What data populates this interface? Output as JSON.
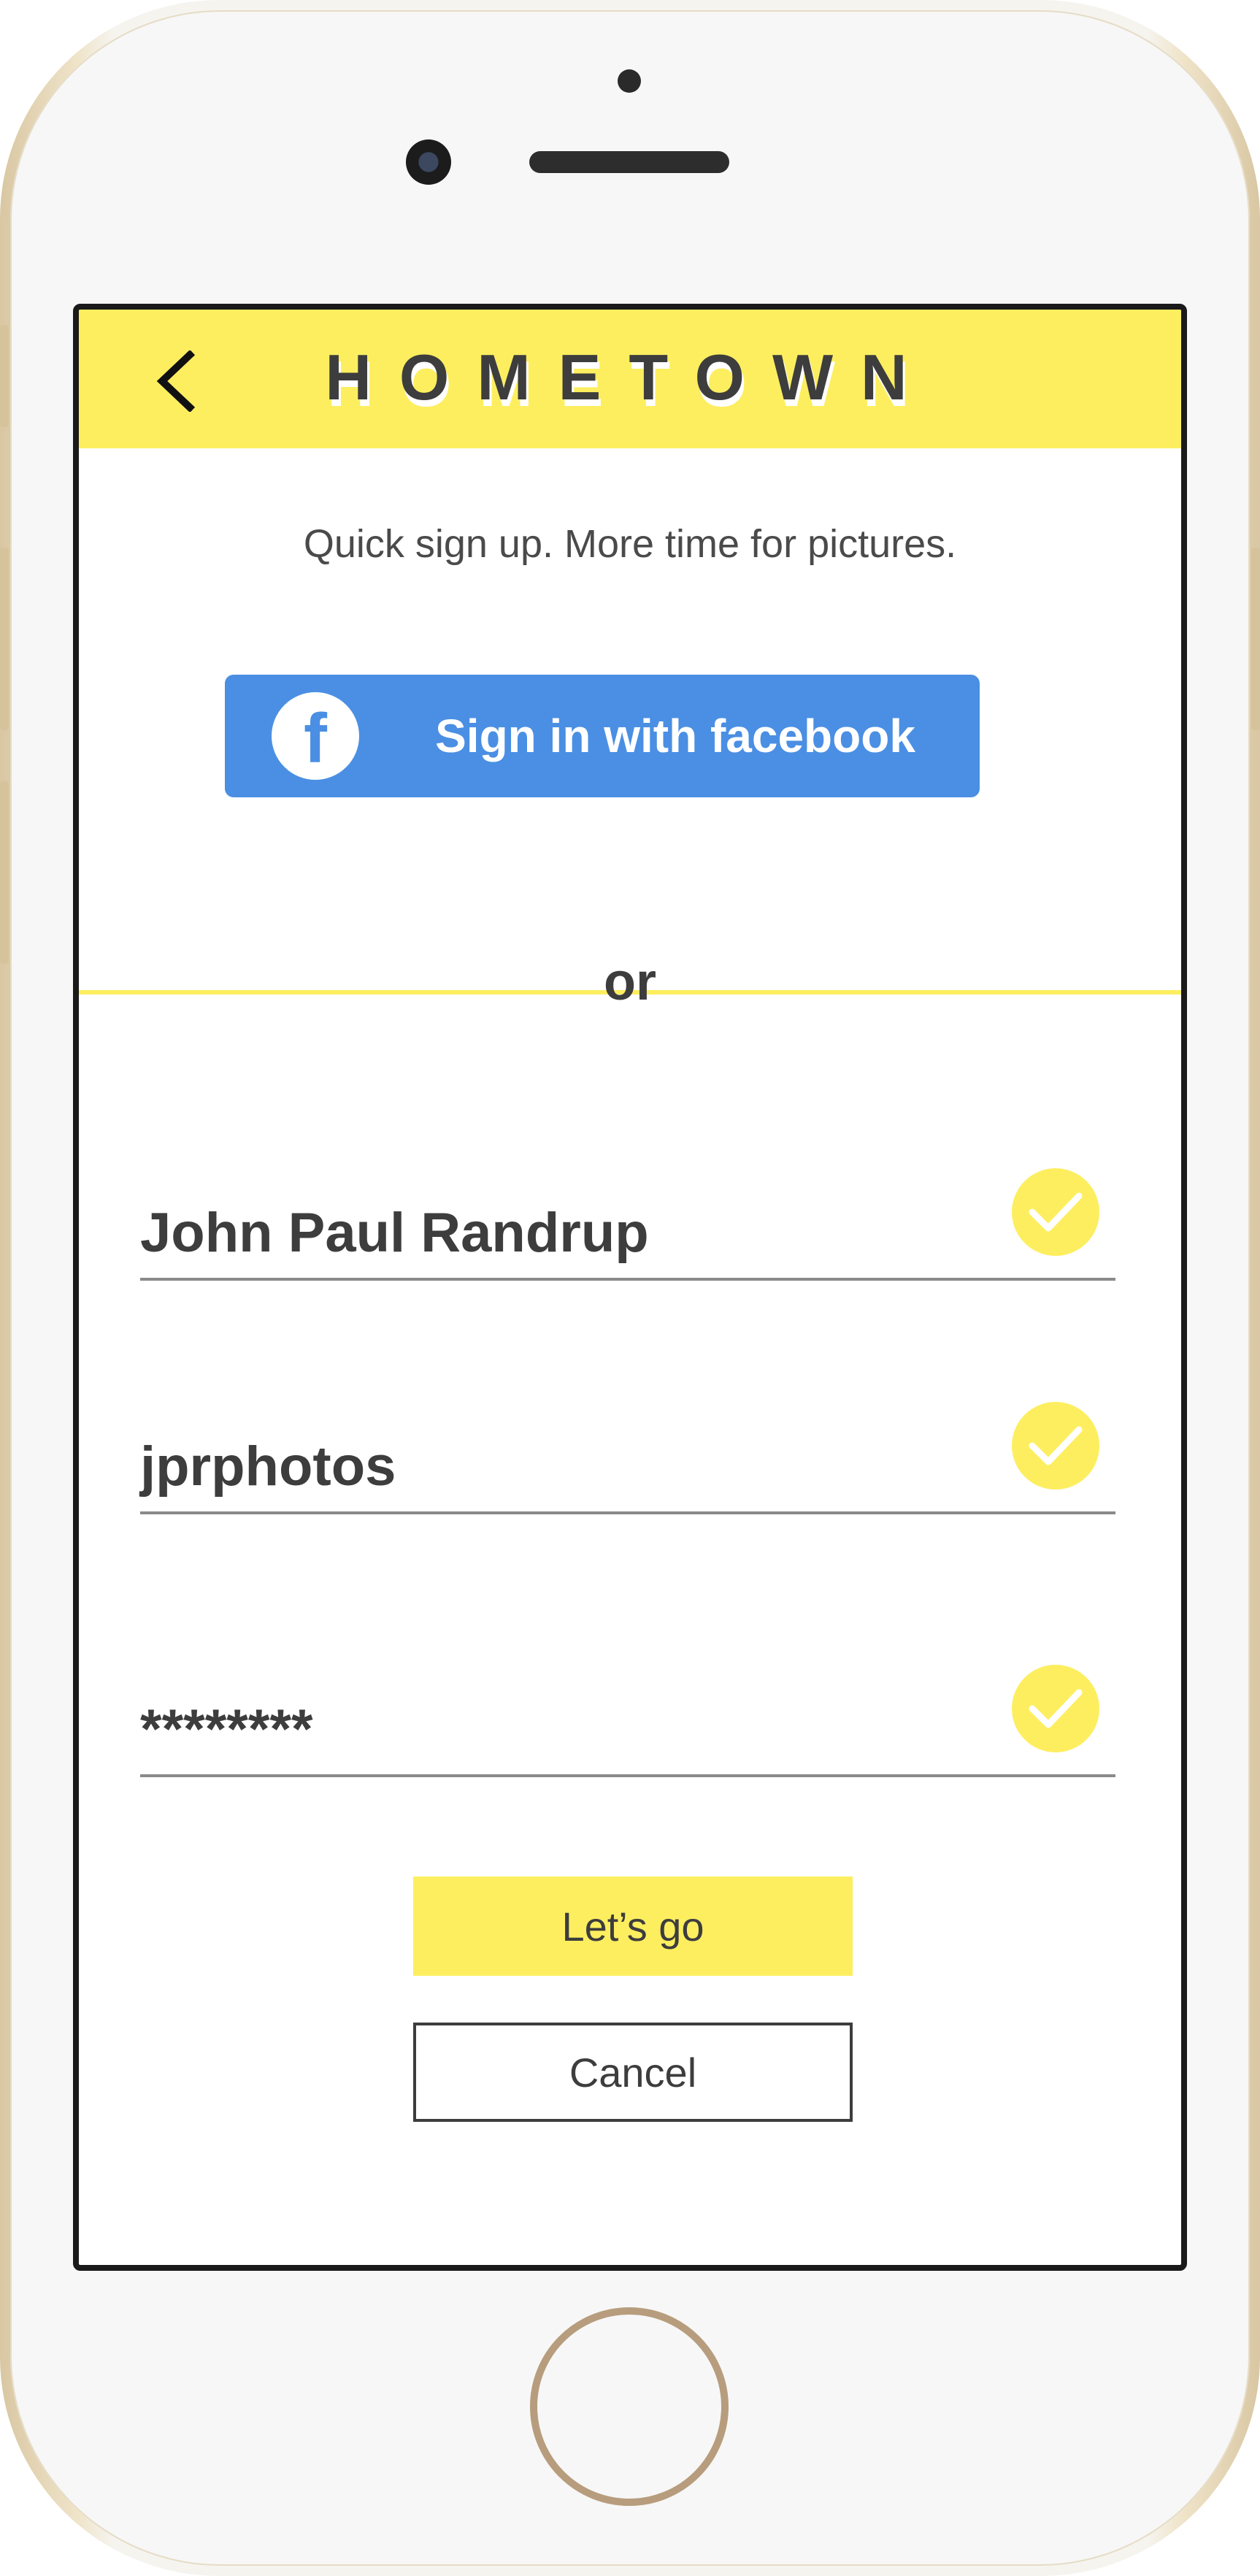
{
  "header": {
    "title": "HOMETOWN",
    "back_icon": "chevron-left-icon"
  },
  "tagline": "Quick sign up. More time for pictures.",
  "facebook_button": {
    "label": "Sign in with facebook",
    "icon": "facebook-icon",
    "icon_letter": "f",
    "color": "#4a8fe3"
  },
  "divider": {
    "label": "or"
  },
  "form": {
    "fields": [
      {
        "value": "John Paul Randrup",
        "valid": true
      },
      {
        "value": "jprphotos",
        "valid": true
      },
      {
        "value": "********",
        "valid": true
      }
    ]
  },
  "actions": {
    "primary_label": "Let’s go",
    "secondary_label": "Cancel"
  },
  "colors": {
    "accent": "#fdee60",
    "text": "#3d3d3d",
    "facebook": "#4a8fe3"
  }
}
